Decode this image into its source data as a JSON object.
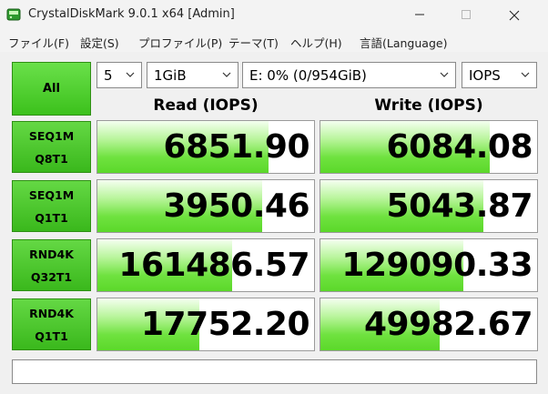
{
  "window": {
    "title": "CrystalDiskMark 9.0.1 x64 [Admin]",
    "minimize_icon": "minimize-icon",
    "maximize_icon": "maximize-icon",
    "close_icon": "close-icon"
  },
  "menu": {
    "items": [
      "ファイル(F)",
      "設定(S)",
      "プロファイル(P)",
      "テーマ(T)",
      "ヘルプ(H)",
      "言語(Language)"
    ]
  },
  "controls": {
    "all_label": "All",
    "count": "5",
    "size": "1GiB",
    "drive": "E: 0% (0/954GiB)",
    "unit": "IOPS"
  },
  "headers": {
    "read": "Read (IOPS)",
    "write": "Write (IOPS)"
  },
  "rows": [
    {
      "line1": "SEQ1M",
      "line2": "Q8T1",
      "read": "6851.90",
      "write": "6084.08",
      "read_fill": 0.79,
      "write_fill": 0.78
    },
    {
      "line1": "SEQ1M",
      "line2": "Q1T1",
      "read": "3950.46",
      "write": "5043.87",
      "read_fill": 0.76,
      "write_fill": 0.75
    },
    {
      "line1": "RND4K",
      "line2": "Q32T1",
      "read": "161486.57",
      "write": "129090.33",
      "read_fill": 0.62,
      "write_fill": 0.66
    },
    {
      "line1": "RND4K",
      "line2": "Q1T1",
      "read": "17752.20",
      "write": "49982.67",
      "read_fill": 0.47,
      "write_fill": 0.55
    }
  ],
  "colors": {
    "accent_green": "#5bd82a",
    "button_green": "#3cc11c"
  }
}
